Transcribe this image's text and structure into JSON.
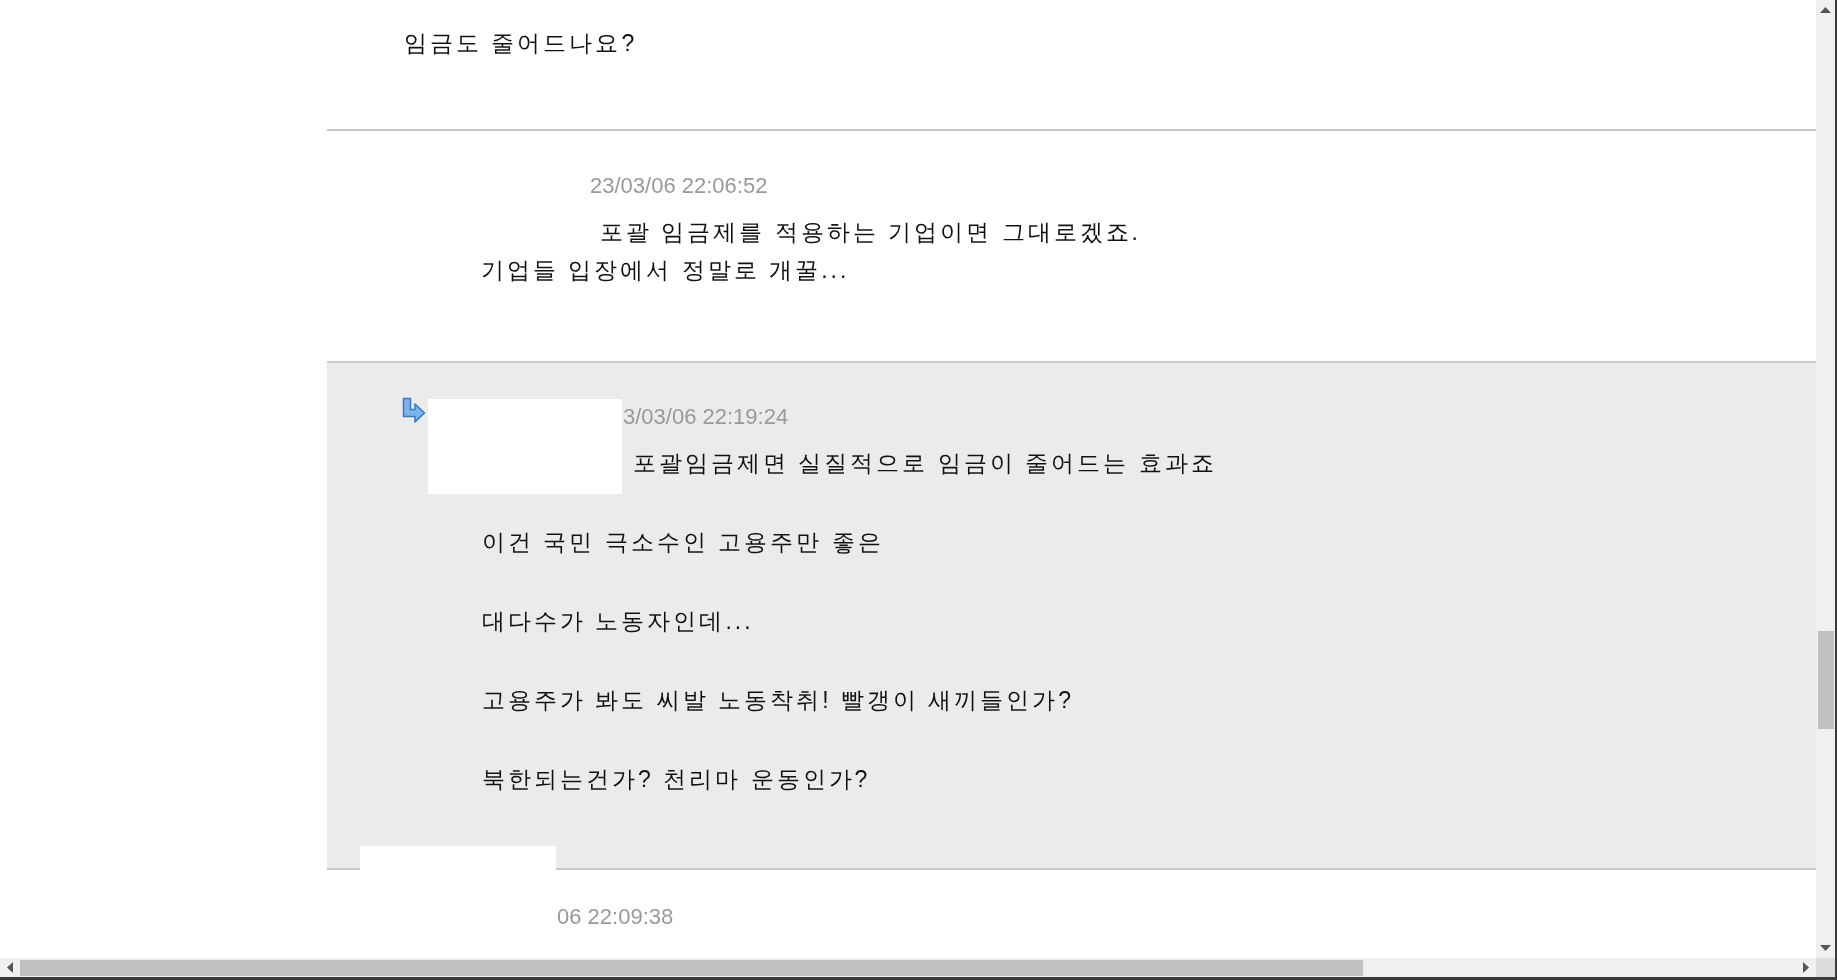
{
  "comments": [
    {
      "kind": "comment",
      "body": [
        "임금도 줄어드나요?"
      ]
    },
    {
      "kind": "comment",
      "date": "23/03/06 22:06:52",
      "body": [
        "포괄 임금제를 적용하는 기업이면 그대로겠죠.",
        "기업들 입장에서 정말로 개꿀..."
      ]
    },
    {
      "kind": "reply",
      "date": "3/03/06 22:19:24",
      "body": [
        "포괄임금제면 실질적으로 임금이 줄어드는 효과죠",
        "이건 국민 극소수인 고용주만 좋은",
        "대다수가 노동자인데...",
        "고용주가 봐도 씨발 노동착취! 빨갱이 새끼들인가?",
        "북한되는건가? 천리마 운동인가?"
      ]
    },
    {
      "kind": "comment",
      "date": "06 22:09:38"
    }
  ]
}
